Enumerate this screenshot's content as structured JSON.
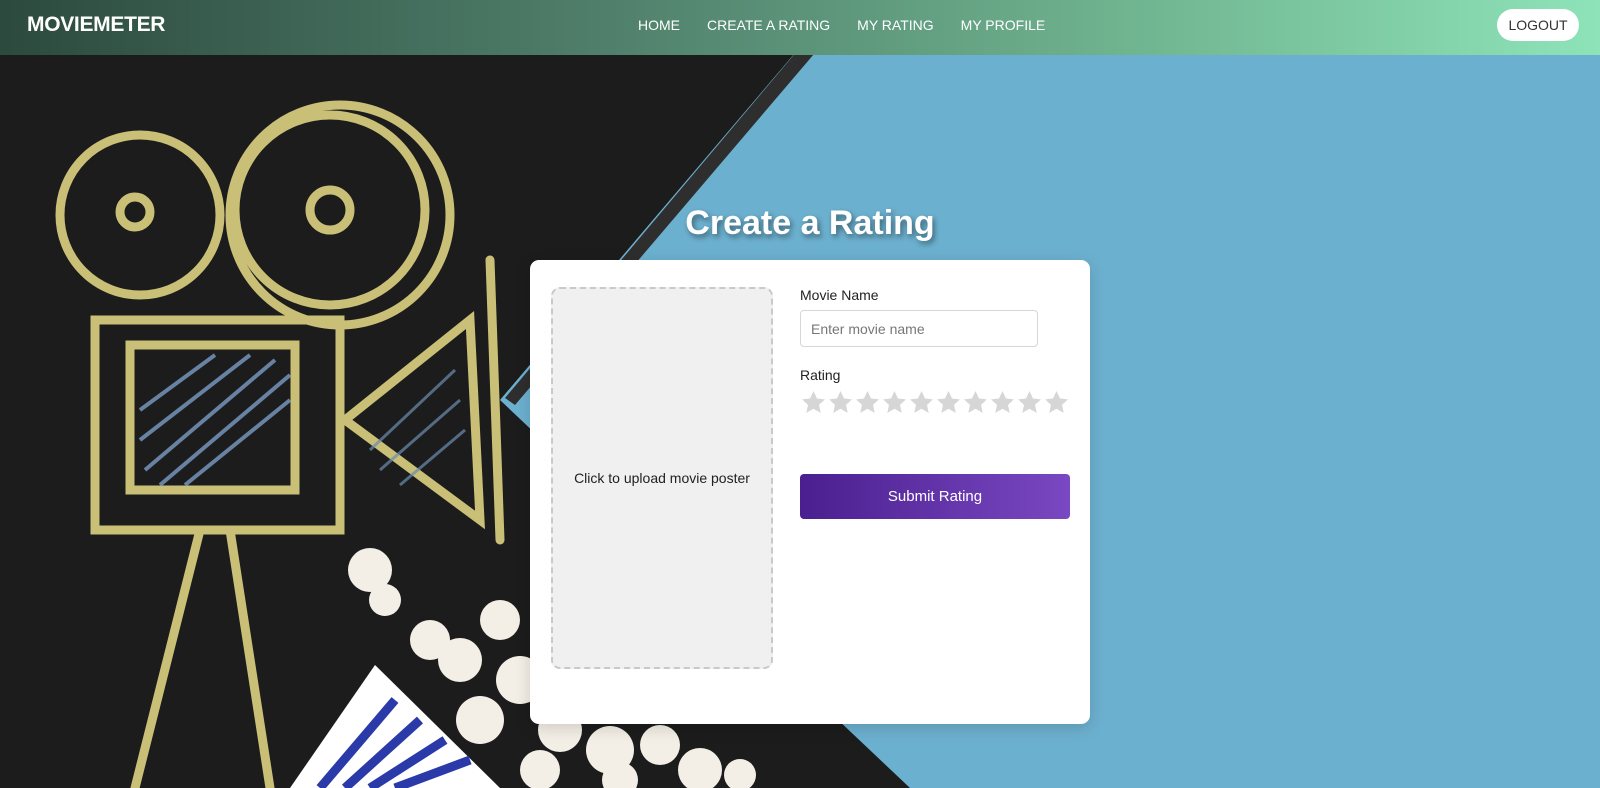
{
  "navbar": {
    "brand": "MOVIEMETER",
    "links": [
      {
        "label": "HOME"
      },
      {
        "label": "CREATE A RATING"
      },
      {
        "label": "MY RATING"
      },
      {
        "label": "MY PROFILE"
      }
    ],
    "logout_label": "LOGOUT"
  },
  "page": {
    "title": "Create a Rating"
  },
  "form": {
    "poster_upload_text": "Click to upload movie poster",
    "movie_name_label": "Movie Name",
    "movie_name_placeholder": "Enter movie name",
    "movie_name_value": "",
    "rating_label": "Rating",
    "rating_max": 10,
    "rating_value": 0,
    "submit_label": "Submit Rating"
  },
  "colors": {
    "nav_gradient_start": "#2c4a3e",
    "nav_gradient_end": "#8ee3b9",
    "submit_gradient_start": "#4a1f8f",
    "submit_gradient_end": "#7a48c2",
    "star_empty": "#d6d6d6",
    "background_blue": "#6cb0cf",
    "chalkboard": "#1c1c1c"
  },
  "icons": {
    "star": "star-icon"
  }
}
